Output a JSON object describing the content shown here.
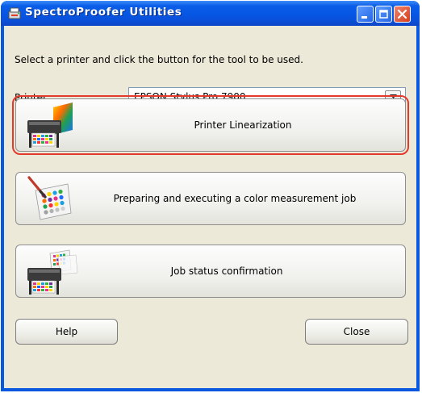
{
  "window": {
    "title": "SpectroProofer Utilities",
    "controls": [
      "minimize-icon",
      "maximize-icon",
      "close-icon"
    ]
  },
  "instruction": "Select a printer and click the button for the tool to be used.",
  "printer": {
    "label": "Printer:",
    "selected": "EPSON Stylus Pro 7900"
  },
  "tools": [
    {
      "label": "Printer Linearization",
      "icon": "printer-linearization-icon",
      "selected": true
    },
    {
      "label": "Preparing and executing a color measurement job",
      "icon": "color-chart-pen-icon",
      "selected": false
    },
    {
      "label": "Job status confirmation",
      "icon": "printer-charts-icon",
      "selected": false
    }
  ],
  "buttons": {
    "help": "Help",
    "close": "Close"
  },
  "colors": {
    "titlebar": "#0656e4",
    "client": "#ece9d8",
    "selection": "#e23a2d"
  }
}
